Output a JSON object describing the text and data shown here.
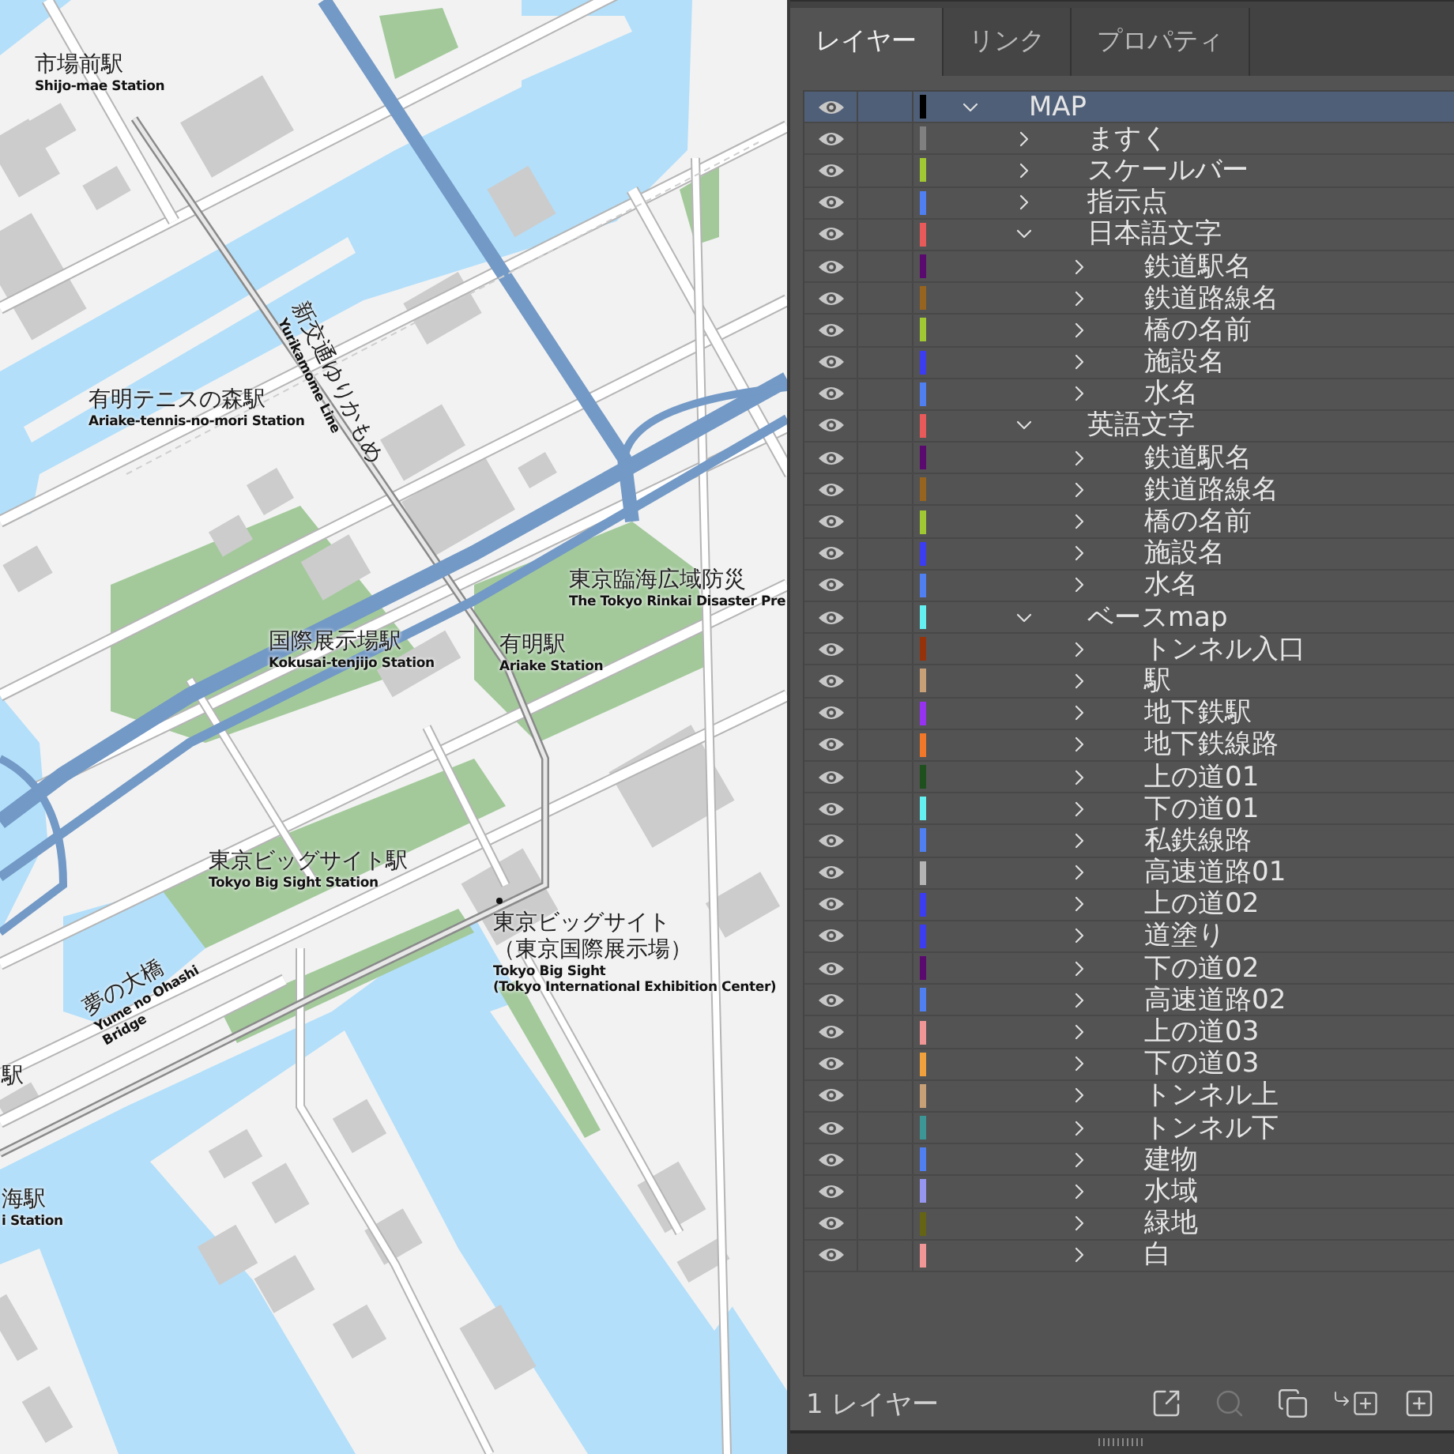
{
  "map": {
    "labels": [
      {
        "kind": "station",
        "ja": [
          "市場前駅"
        ],
        "en": [
          "Shijo-mae Station"
        ]
      },
      {
        "kind": "line",
        "ja": [
          "新交通ゆりかもめ"
        ],
        "en": [
          "Yurikamome Line"
        ]
      },
      {
        "kind": "station",
        "ja": [
          "有明テニスの森駅"
        ],
        "en": [
          "Ariake-tennis-no-mori Station"
        ]
      },
      {
        "kind": "station",
        "ja": [
          "国際展示場駅"
        ],
        "en": [
          "Kokusai-tenjijo Station"
        ]
      },
      {
        "kind": "facility",
        "ja": [
          "東京臨海広域防災"
        ],
        "en": [
          "The Tokyo Rinkai Disaster Pre"
        ]
      },
      {
        "kind": "station",
        "ja": [
          "有明駅"
        ],
        "en": [
          "Ariake Station"
        ]
      },
      {
        "kind": "station",
        "ja": [
          "東京ビッグサイト駅"
        ],
        "en": [
          "Tokyo Big Sight Station"
        ]
      },
      {
        "kind": "landmark",
        "ja": [
          "東京ビッグサイト",
          "（東京国際展示場）"
        ],
        "en": [
          "Tokyo Big Sight",
          "(Tokyo International Exhibition Center)"
        ]
      },
      {
        "kind": "bridge",
        "ja": [
          "夢の大橋"
        ],
        "en": [
          "Yume no Ohashi",
          "Bridge"
        ]
      },
      {
        "kind": "station",
        "ja": [
          "駅"
        ]
      },
      {
        "kind": "station",
        "ja": [
          "海駅"
        ],
        "en": [
          "i Station"
        ]
      }
    ]
  },
  "panel": {
    "tabs": [
      {
        "label": "レイヤー",
        "selected": true
      },
      {
        "label": "リンク",
        "selected": false
      },
      {
        "label": "プロパティ",
        "selected": false
      }
    ],
    "layers": [
      {
        "name": "MAP",
        "color": "#000000",
        "visible": true,
        "selected": true,
        "expanded": true,
        "children": [
          {
            "name": "ますく",
            "color": "#808080",
            "visible": true,
            "selected": false,
            "expanded": false
          },
          {
            "name": "スケールバー",
            "color": "#a0c832",
            "visible": true,
            "selected": false,
            "expanded": false
          },
          {
            "name": "指示点",
            "color": "#4f7ff0",
            "visible": true,
            "selected": false,
            "expanded": false
          },
          {
            "name": "日本語文字",
            "color": "#e85a5a",
            "visible": true,
            "selected": false,
            "expanded": true,
            "children": [
              {
                "name": "鉄道駅名",
                "color": "#5a0a6e",
                "visible": true,
                "selected": false,
                "expanded": false
              },
              {
                "name": "鉄道路線名",
                "color": "#96641e",
                "visible": true,
                "selected": false,
                "expanded": false
              },
              {
                "name": "橋の名前",
                "color": "#a0c832",
                "visible": true,
                "selected": false,
                "expanded": false
              },
              {
                "name": "施設名",
                "color": "#3c3cf0",
                "visible": true,
                "selected": false,
                "expanded": false
              },
              {
                "name": "水名",
                "color": "#4f7ff0",
                "visible": true,
                "selected": false,
                "expanded": false
              }
            ]
          },
          {
            "name": "英語文字",
            "color": "#e85a5a",
            "visible": true,
            "selected": false,
            "expanded": true,
            "children": [
              {
                "name": "鉄道駅名",
                "color": "#5a0a6e",
                "visible": true,
                "selected": false,
                "expanded": false
              },
              {
                "name": "鉄道路線名",
                "color": "#96641e",
                "visible": true,
                "selected": false,
                "expanded": false
              },
              {
                "name": "橋の名前",
                "color": "#a0c832",
                "visible": true,
                "selected": false,
                "expanded": false
              },
              {
                "name": "施設名",
                "color": "#3c3cf0",
                "visible": true,
                "selected": false,
                "expanded": false
              },
              {
                "name": "水名",
                "color": "#4f7ff0",
                "visible": true,
                "selected": false,
                "expanded": false
              }
            ]
          },
          {
            "name": "ベースmap",
            "color": "#64f0f0",
            "visible": true,
            "selected": false,
            "expanded": true,
            "children": [
              {
                "name": "トンネル入口",
                "color": "#96320a",
                "visible": true,
                "selected": false,
                "expanded": false
              },
              {
                "name": "駅",
                "color": "#c8a078",
                "visible": true,
                "selected": false,
                "expanded": false
              },
              {
                "name": "地下鉄駅",
                "color": "#9632f0",
                "visible": true,
                "selected": false,
                "expanded": false
              },
              {
                "name": "地下鉄線路",
                "color": "#f07828",
                "visible": true,
                "selected": false,
                "expanded": false
              },
              {
                "name": "上の道01",
                "color": "#1e501e",
                "visible": true,
                "selected": false,
                "expanded": false
              },
              {
                "name": "下の道01",
                "color": "#64f0f0",
                "visible": true,
                "selected": false,
                "expanded": false
              },
              {
                "name": "私鉄線路",
                "color": "#4f7ff0",
                "visible": true,
                "selected": false,
                "expanded": false
              },
              {
                "name": "高速道路01",
                "color": "#b4b4b4",
                "visible": true,
                "selected": false,
                "expanded": false
              },
              {
                "name": "上の道02",
                "color": "#3c3cf0",
                "visible": true,
                "selected": false,
                "expanded": false
              },
              {
                "name": "道塗り",
                "color": "#3c3cf0",
                "visible": true,
                "selected": false,
                "expanded": false
              },
              {
                "name": "下の道02",
                "color": "#5a0a6e",
                "visible": true,
                "selected": false,
                "expanded": false
              },
              {
                "name": "高速道路02",
                "color": "#4f7ff0",
                "visible": true,
                "selected": false,
                "expanded": false
              },
              {
                "name": "上の道03",
                "color": "#f09696",
                "visible": true,
                "selected": false,
                "expanded": false
              },
              {
                "name": "下の道03",
                "color": "#f0a03c",
                "visible": true,
                "selected": false,
                "expanded": false
              },
              {
                "name": "トンネル上",
                "color": "#c8a078",
                "visible": true,
                "selected": false,
                "expanded": false
              },
              {
                "name": "トンネル下",
                "color": "#3c9696",
                "visible": true,
                "selected": false,
                "expanded": false
              },
              {
                "name": "建物",
                "color": "#4f7ff0",
                "visible": true,
                "selected": false,
                "expanded": false
              },
              {
                "name": "水域",
                "color": "#9696f0",
                "visible": true,
                "selected": false,
                "expanded": false
              },
              {
                "name": "緑地",
                "color": "#646414",
                "visible": true,
                "selected": false,
                "expanded": false
              },
              {
                "name": "白",
                "color": "#f09696",
                "visible": true,
                "selected": false,
                "expanded": false
              }
            ]
          }
        ]
      }
    ],
    "footer": {
      "count": "1 レイヤー"
    }
  }
}
